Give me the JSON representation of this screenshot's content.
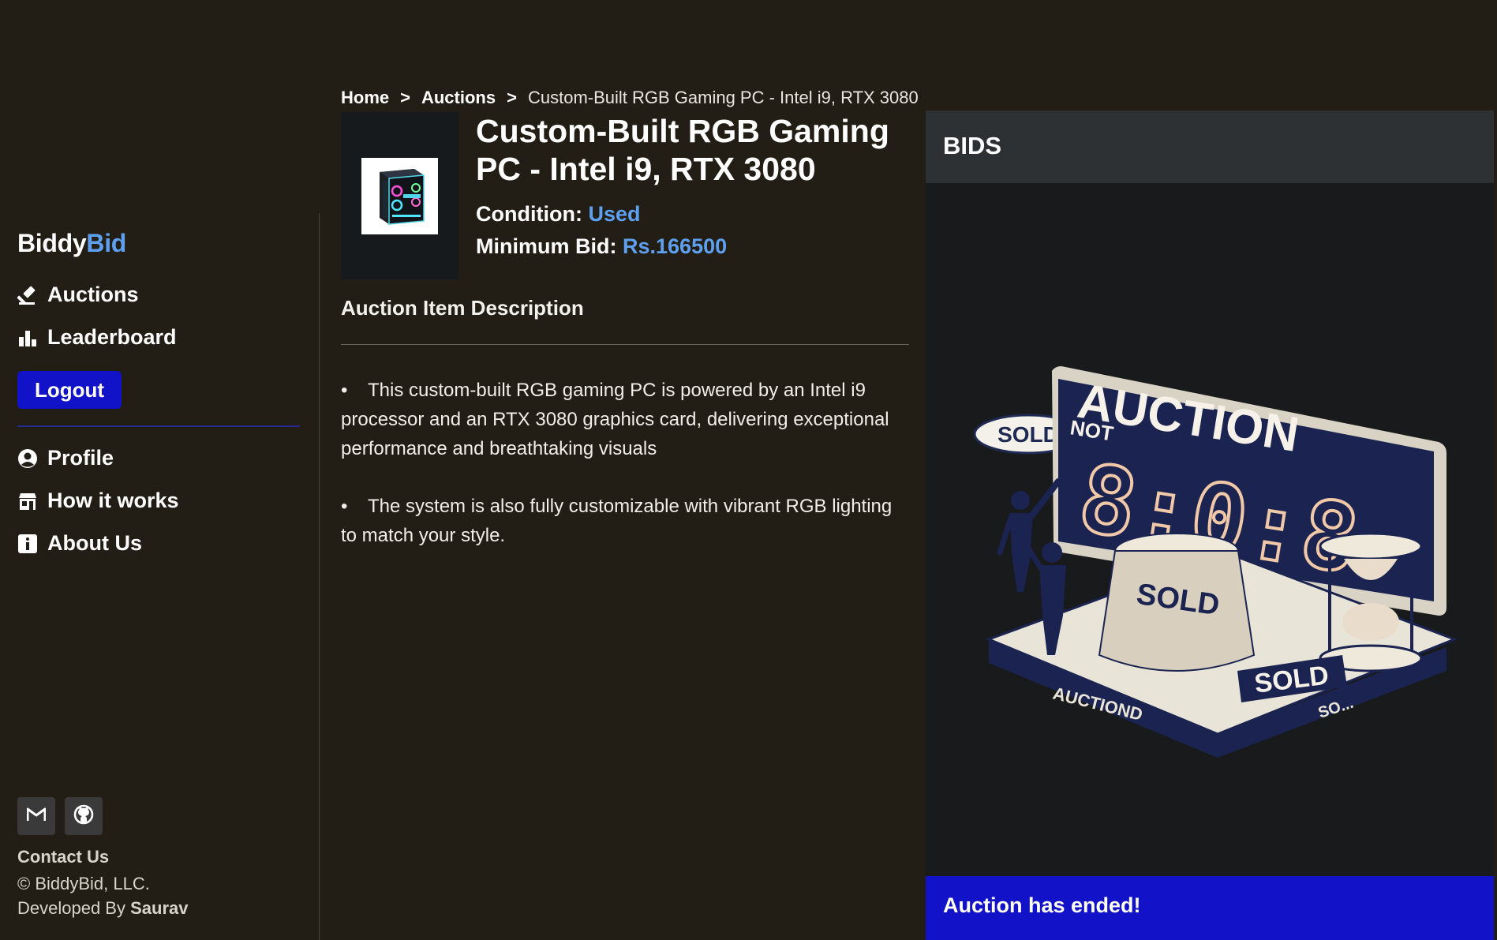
{
  "sidebar": {
    "brand_part1": "Biddy",
    "brand_part2": "Bid",
    "nav_top": [
      {
        "label": "Auctions",
        "icon": "gavel-icon"
      },
      {
        "label": "Leaderboard",
        "icon": "bar-chart-icon"
      }
    ],
    "logout_label": "Logout",
    "nav_bottom": [
      {
        "label": "Profile",
        "icon": "user-circle-icon"
      },
      {
        "label": "How it works",
        "icon": "store-icon"
      },
      {
        "label": "About Us",
        "icon": "info-icon"
      }
    ],
    "social": [
      {
        "icon": "gmail-icon"
      },
      {
        "icon": "github-icon"
      }
    ],
    "contact_label": "Contact Us",
    "copyright": "© BiddyBid, LLC.",
    "developed_by_prefix": "Developed By",
    "developer": "Saurav"
  },
  "breadcrumb": {
    "items": [
      "Home",
      "Auctions"
    ],
    "separator": ">",
    "current": "Custom-Built RGB Gaming PC - Intel i9, RTX 3080"
  },
  "item": {
    "title": "Custom-Built RGB Gaming PC - Intel i9, RTX 3080",
    "condition_label": "Condition:",
    "condition_value": "Used",
    "min_bid_label": "Minimum Bid:",
    "min_bid_value": "Rs.166500",
    "thumbnail_icon": "gaming-pc-image"
  },
  "description": {
    "heading": "Auction Item Description",
    "bullet": "•",
    "paragraphs": [
      "This custom-built RGB gaming PC is powered by an Intel i9 processor and an RTX 3080 graphics card, delivering exceptional performance and breathtaking visuals",
      "The system is also fully customizable with vibrant RGB lighting to match your style."
    ]
  },
  "bids": {
    "title": "BIDS",
    "illustration": {
      "sold_left": "SOLD",
      "auction_word": "AUCTION",
      "not_word": "NOT",
      "timer": "8:0:8",
      "sold_cloth": "SOLD",
      "sold_sign": "SOLD",
      "base_left": "AUCTIOND",
      "base_right": "SO..."
    },
    "status": "Auction has ended!"
  },
  "colors": {
    "background": "#231e15",
    "accent_blue": "#5da0f0",
    "button_blue": "#1212c8",
    "panel_bg": "#181a1c",
    "panel_header": "#2d3134"
  }
}
